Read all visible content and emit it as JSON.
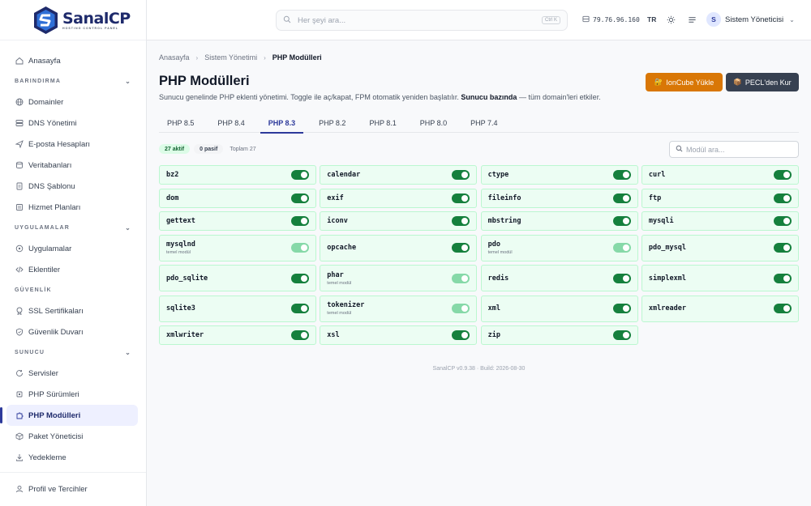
{
  "brand": {
    "name": "SanalCP",
    "tagline": "HOSTING CONTROL PANEL"
  },
  "sidebar": {
    "home": "Anasayfa",
    "sections": [
      {
        "title": "BARINDIRMA",
        "items": [
          "Domainler",
          "DNS Yönetimi",
          "E-posta Hesapları",
          "Veritabanları",
          "DNS Şablonu",
          "Hizmet Planları"
        ]
      },
      {
        "title": "UYGULAMALAR",
        "items": [
          "Uygulamalar",
          "Eklentiler"
        ]
      },
      {
        "title": "GÜVENLİK",
        "items": [
          "SSL Sertifikaları",
          "Güvenlik Duvarı"
        ]
      },
      {
        "title": "SUNUCU",
        "items": [
          "Servisler",
          "PHP Sürümleri",
          "PHP Modülleri",
          "Paket Yöneticisi",
          "Yedekleme"
        ]
      }
    ],
    "profile": "Profil ve Tercihler"
  },
  "topbar": {
    "search_placeholder": "Her şeyi ara...",
    "search_shortcut": "Ctrl K",
    "ip": "79.76.96.160",
    "lang": "TR",
    "user_initial": "S",
    "user_name": "Sistem Yöneticisi"
  },
  "breadcrumb": [
    "Anasayfa",
    "Sistem Yönetimi",
    "PHP Modülleri"
  ],
  "page": {
    "title": "PHP Modülleri",
    "desc_pre": "Sunucu genelinde PHP eklenti yönetimi. Toggle ile aç/kapat, FPM otomatik yeniden başlatılır.",
    "desc_bold": "Sunucu bazında",
    "desc_post": "— tüm domain'leri etkiler.",
    "btn_ioncube": "IonCube Yükle",
    "btn_pecl": "PECL'den Kur"
  },
  "tabs": [
    "PHP 8.5",
    "PHP 8.4",
    "PHP 8.3",
    "PHP 8.2",
    "PHP 8.1",
    "PHP 8.0",
    "PHP 7.4"
  ],
  "active_tab": "PHP 8.3",
  "stats": {
    "active": "27 aktif",
    "passive": "0 pasif",
    "total": "Toplam 27"
  },
  "filter_placeholder": "Modül ara...",
  "modules": [
    {
      "name": "bz2",
      "on": true
    },
    {
      "name": "calendar",
      "on": true
    },
    {
      "name": "ctype",
      "on": true
    },
    {
      "name": "curl",
      "on": true
    },
    {
      "name": "dom",
      "on": true
    },
    {
      "name": "exif",
      "on": true
    },
    {
      "name": "fileinfo",
      "on": true
    },
    {
      "name": "ftp",
      "on": true
    },
    {
      "name": "gettext",
      "on": true
    },
    {
      "name": "iconv",
      "on": true
    },
    {
      "name": "mbstring",
      "on": true
    },
    {
      "name": "mysqli",
      "on": true
    },
    {
      "name": "mysqlnd",
      "note": "temel modül",
      "on": true,
      "locked": true
    },
    {
      "name": "opcache",
      "on": true
    },
    {
      "name": "pdo",
      "note": "temel modül",
      "on": true,
      "locked": true
    },
    {
      "name": "pdo_mysql",
      "on": true
    },
    {
      "name": "pdo_sqlite",
      "on": true
    },
    {
      "name": "phar",
      "note": "temel modül",
      "on": true,
      "locked": true
    },
    {
      "name": "redis",
      "on": true
    },
    {
      "name": "simplexml",
      "on": true
    },
    {
      "name": "sqlite3",
      "on": true
    },
    {
      "name": "tokenizer",
      "note": "temel modül",
      "on": true,
      "locked": true
    },
    {
      "name": "xml",
      "on": true
    },
    {
      "name": "xmlreader",
      "on": true
    },
    {
      "name": "xmlwriter",
      "on": true
    },
    {
      "name": "xsl",
      "on": true
    },
    {
      "name": "zip",
      "on": true
    }
  ],
  "footer": "SanalCP v0.9.38 · Build: 2026-08-30"
}
